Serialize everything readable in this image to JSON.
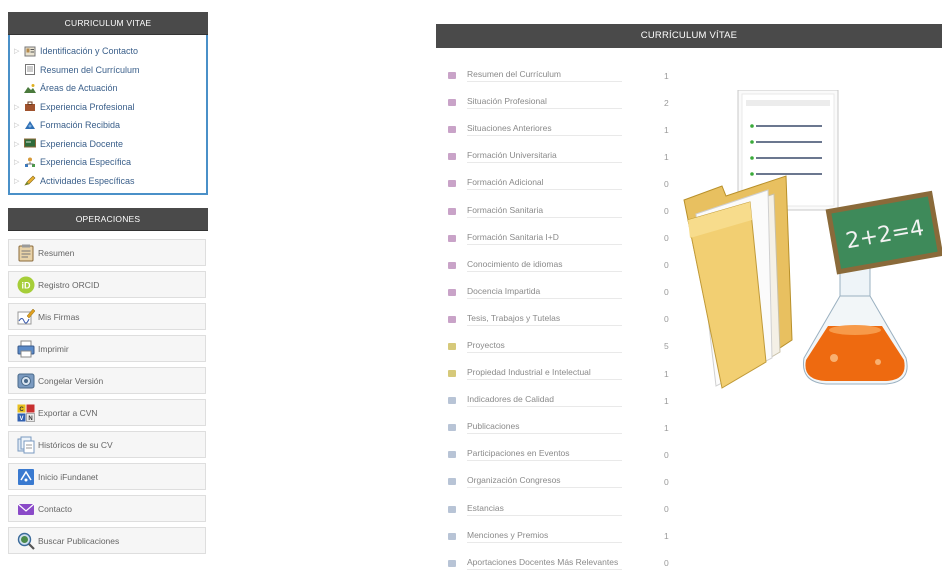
{
  "sidebar_cv": {
    "title": "CURRICULUM VITAE",
    "items": [
      {
        "label": "Identificación y Contacto",
        "icon": "id-card-icon"
      },
      {
        "label": "Resumen del Currículum",
        "icon": "document-icon"
      },
      {
        "label": "Áreas de Actuación",
        "icon": "landscape-icon"
      },
      {
        "label": "Experiencia Profesional",
        "icon": "briefcase-icon"
      },
      {
        "label": "Formación Recibida",
        "icon": "pin-icon"
      },
      {
        "label": "Experiencia Docente",
        "icon": "chalkboard-icon"
      },
      {
        "label": "Experiencia Específica",
        "icon": "user-tree-icon"
      },
      {
        "label": "Actividades Específicas",
        "icon": "pencil-icon"
      }
    ]
  },
  "operaciones": {
    "title": "OPERACIONES",
    "items": [
      {
        "label": "Resumen",
        "icon": "clipboard-icon"
      },
      {
        "label": "Registro ORCID",
        "icon": "orcid-icon"
      },
      {
        "label": "Mis Firmas",
        "icon": "signature-icon"
      },
      {
        "label": "Imprimir",
        "icon": "printer-icon"
      },
      {
        "label": "Congelar Versión",
        "icon": "snapshot-icon"
      },
      {
        "label": "Exportar a CVN",
        "icon": "cvn-icon"
      },
      {
        "label": "Históricos de su CV",
        "icon": "history-icon"
      },
      {
        "label": "Inicio iFundanet",
        "icon": "home-icon"
      },
      {
        "label": "Contacto",
        "icon": "mail-icon"
      },
      {
        "label": "Buscar Publicaciones",
        "icon": "search-icon"
      }
    ]
  },
  "main": {
    "title": "CURRÍCULUM VÍTAE",
    "rows": [
      {
        "label": "Resumen del Currículum",
        "count": "1",
        "color": "#c9a3c8"
      },
      {
        "label": "Situación Profesional",
        "count": "2",
        "color": "#c9a3c8"
      },
      {
        "label": "Situaciones Anteriores",
        "count": "1",
        "color": "#c9a3c8"
      },
      {
        "label": "Formación Universitaria",
        "count": "1",
        "color": "#c9a3c8"
      },
      {
        "label": "Formación Adicional",
        "count": "0",
        "color": "#c9a3c8"
      },
      {
        "label": "Formación Sanitaria",
        "count": "0",
        "color": "#c9a3c8"
      },
      {
        "label": "Formación Sanitaria I+D",
        "count": "0",
        "color": "#c9a3c8"
      },
      {
        "label": "Conocimiento de idiomas",
        "count": "0",
        "color": "#c9a3c8"
      },
      {
        "label": "Docencia Impartida",
        "count": "0",
        "color": "#c9a3c8"
      },
      {
        "label": "Tesis, Trabajos y Tutelas",
        "count": "0",
        "color": "#c9a3c8"
      },
      {
        "label": "Proyectos",
        "count": "5",
        "color": "#d6c97a"
      },
      {
        "label": "Propiedad Industrial e Intelectual",
        "count": "1",
        "color": "#d6c97a"
      },
      {
        "label": "Indicadores de Calidad",
        "count": "1",
        "color": "#b8c4d6"
      },
      {
        "label": "Publicaciones",
        "count": "1",
        "color": "#b8c4d6"
      },
      {
        "label": "Participaciones en Eventos",
        "count": "0",
        "color": "#b8c4d6"
      },
      {
        "label": "Organización Congresos",
        "count": "0",
        "color": "#b8c4d6"
      },
      {
        "label": "Estancias",
        "count": "0",
        "color": "#b8c4d6"
      },
      {
        "label": "Menciones y Premios",
        "count": "1",
        "color": "#b8c4d6"
      },
      {
        "label": "Aportaciones Docentes Más Relevantes",
        "count": "0",
        "color": "#b8c4d6"
      }
    ],
    "illustration": {
      "chalkboard_text": "2+2=4"
    }
  }
}
